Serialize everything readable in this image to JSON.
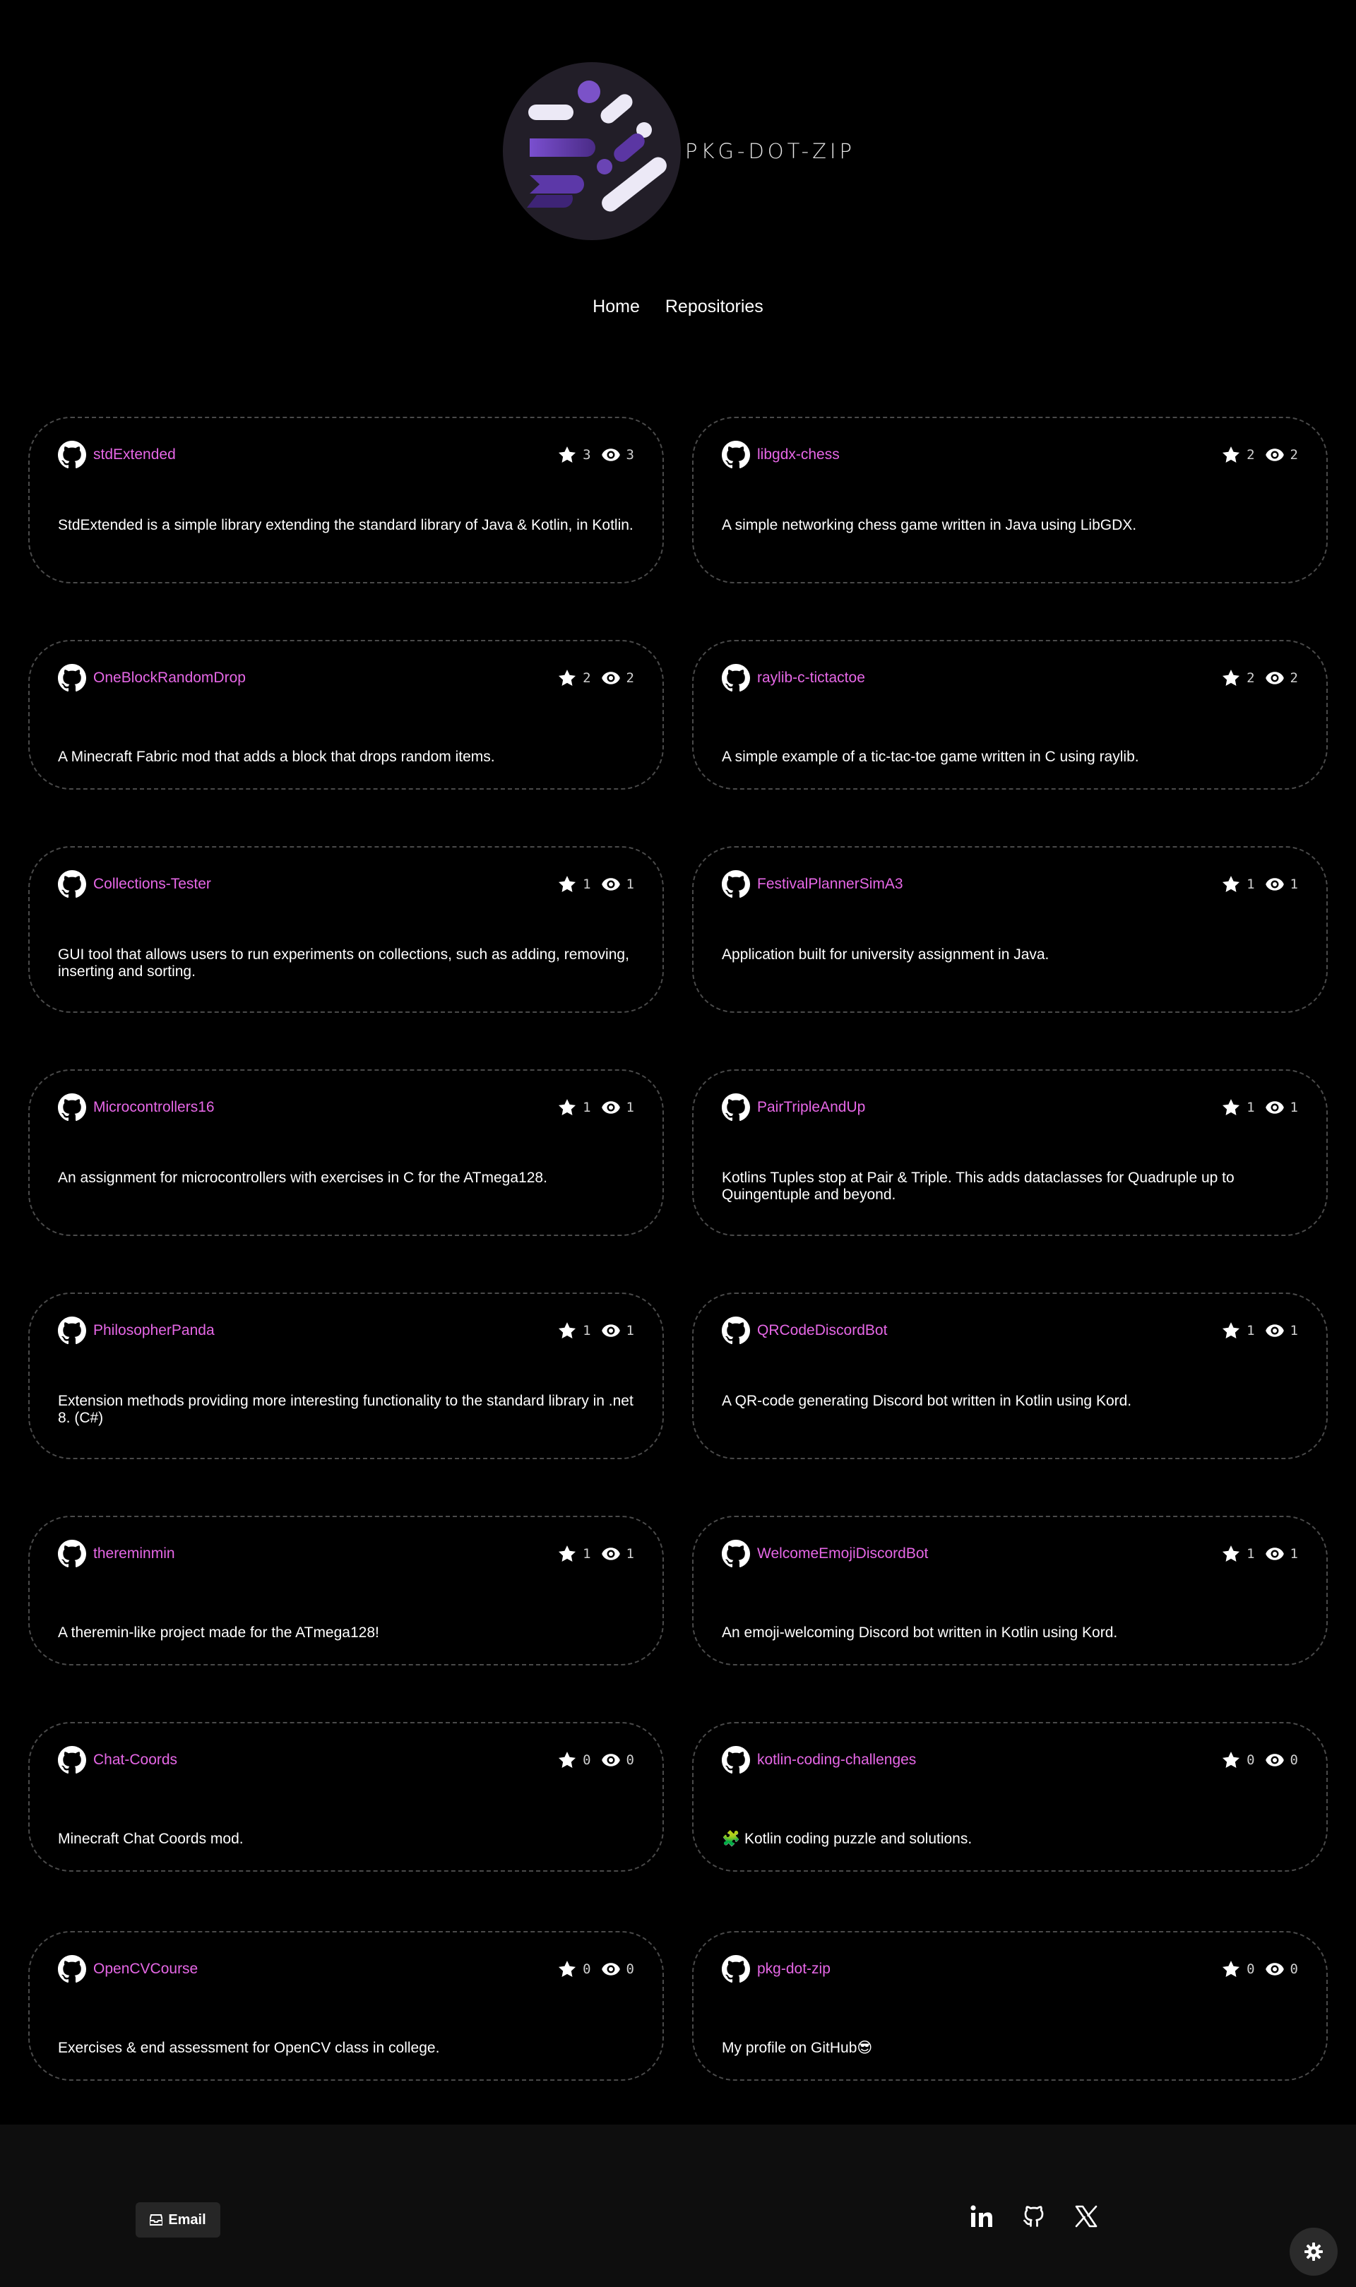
{
  "brand": {
    "name": "PKG-DOT-ZIP"
  },
  "nav": [
    {
      "label": "Home"
    },
    {
      "label": "Repositories"
    }
  ],
  "repos": [
    {
      "name": "stdExtended",
      "stars": "3",
      "watchers": "3",
      "description": "StdExtended is a simple library extending the standard library of Java & Kotlin, in Kotlin."
    },
    {
      "name": "libgdx-chess",
      "stars": "2",
      "watchers": "2",
      "description": "A simple networking chess game written in Java using LibGDX."
    },
    {
      "name": "OneBlockRandomDrop",
      "stars": "2",
      "watchers": "2",
      "description": "A Minecraft Fabric mod that adds a block that drops random items."
    },
    {
      "name": "raylib-c-tictactoe",
      "stars": "2",
      "watchers": "2",
      "description": "A simple example of a tic-tac-toe game written in C using raylib."
    },
    {
      "name": "Collections-Tester",
      "stars": "1",
      "watchers": "1",
      "description": "GUI tool that allows users to run experiments on collections, such as adding, removing, inserting and sorting."
    },
    {
      "name": "FestivalPlannerSimA3",
      "stars": "1",
      "watchers": "1",
      "description": "Application built for university assignment in Java."
    },
    {
      "name": "Microcontrollers16",
      "stars": "1",
      "watchers": "1",
      "description": "An assignment for microcontrollers with exercises in C for the ATmega128."
    },
    {
      "name": "PairTripleAndUp",
      "stars": "1",
      "watchers": "1",
      "description": "Kotlins Tuples stop at Pair & Triple. This adds dataclasses for Quadruple up to Quingentuple and beyond."
    },
    {
      "name": "PhilosopherPanda",
      "stars": "1",
      "watchers": "1",
      "description": "Extension methods providing more interesting functionality to the standard library in .net 8. (C#)"
    },
    {
      "name": "QRCodeDiscordBot",
      "stars": "1",
      "watchers": "1",
      "description": "A QR-code generating Discord bot written in Kotlin using Kord."
    },
    {
      "name": "thereminmin",
      "stars": "1",
      "watchers": "1",
      "description": "A theremin-like project made for the ATmega128!"
    },
    {
      "name": "WelcomeEmojiDiscordBot",
      "stars": "1",
      "watchers": "1",
      "description": "An emoji-welcoming Discord bot written in Kotlin using Kord."
    },
    {
      "name": "Chat-Coords",
      "stars": "0",
      "watchers": "0",
      "description": "Minecraft Chat Coords mod."
    },
    {
      "name": "kotlin-coding-challenges",
      "stars": "0",
      "watchers": "0",
      "description": "🧩 Kotlin coding puzzle and solutions."
    },
    {
      "name": "OpenCVCourse",
      "stars": "0",
      "watchers": "0",
      "description": "Exercises & end assessment for OpenCV class in college."
    },
    {
      "name": "pkg-dot-zip",
      "stars": "0",
      "watchers": "0",
      "description": "My profile on GitHub😎"
    }
  ],
  "footer": {
    "email_label": "Email",
    "socials": [
      "linkedin-icon",
      "github-icon",
      "x-icon"
    ]
  },
  "colors": {
    "accent": "#e667e6",
    "background": "#000000",
    "card_border": "#4a4a4a",
    "footer_bg": "#0e0e0e"
  }
}
